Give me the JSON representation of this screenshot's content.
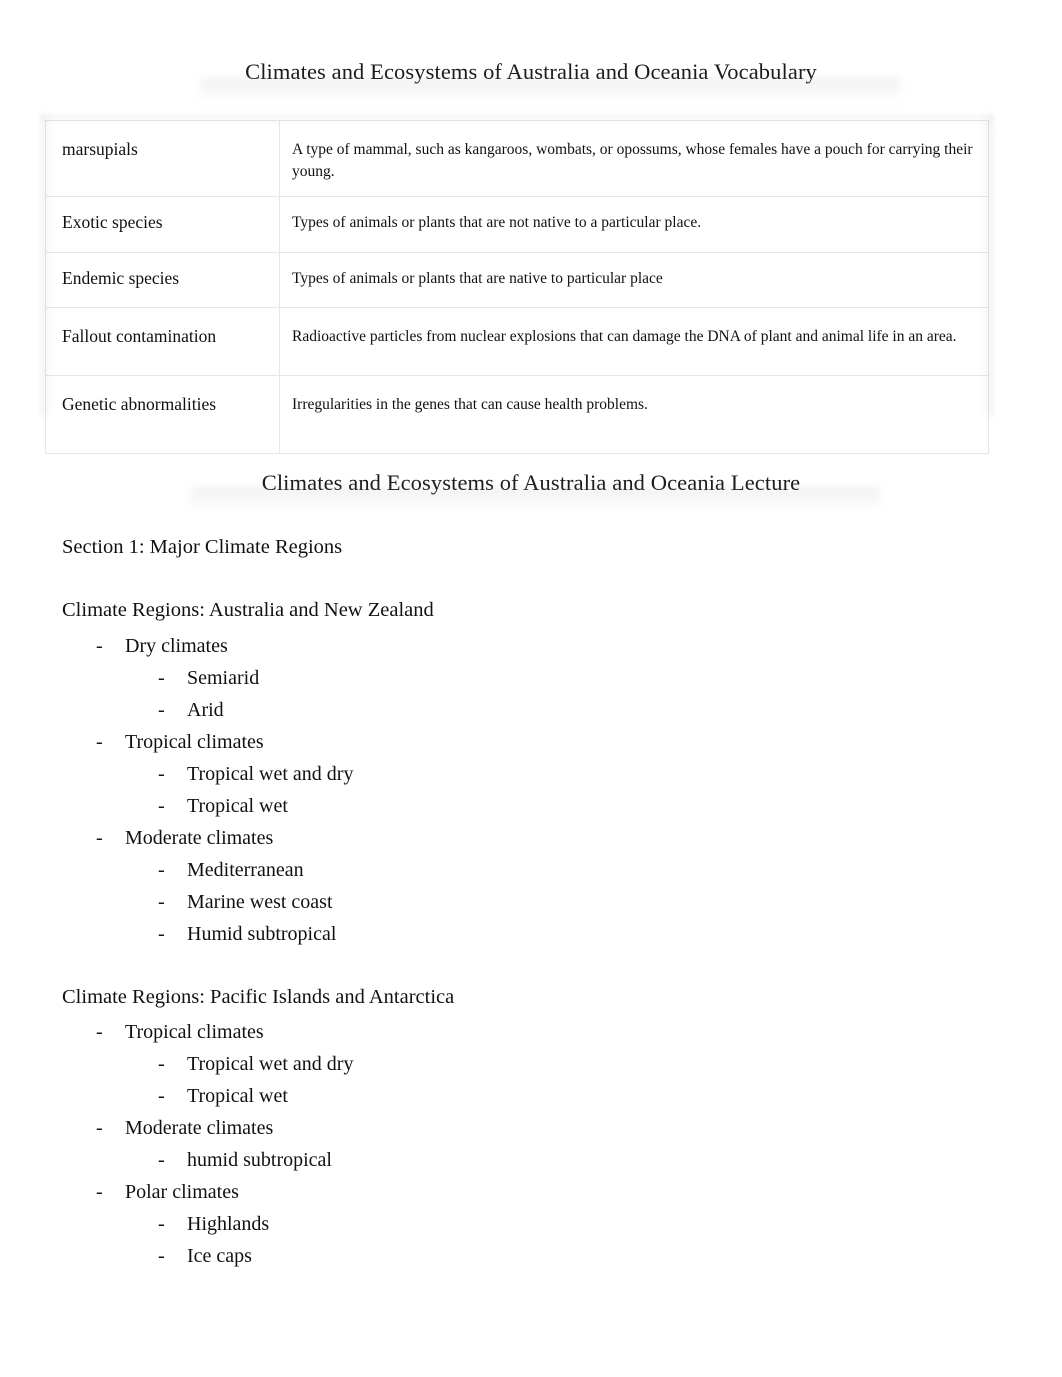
{
  "document": {
    "vocabulary_title": "Climates and Ecosystems of Australia and Oceania Vocabulary",
    "lecture_title": "Climates and Ecosystems of Australia and Oceania Lecture"
  },
  "vocabulary_table": {
    "rows": [
      {
        "term": "marsupials",
        "definition": "A type of mammal, such as kangaroos, wombats, or opossums, whose females have a pouch for carrying their young."
      },
      {
        "term": "Exotic species",
        "definition": "Types of animals or plants that are not native to a particular place."
      },
      {
        "term": "Endemic species",
        "definition": "Types of animals or plants that are native to particular place"
      },
      {
        "term": "Fallout contamination",
        "definition": "Radioactive particles from nuclear explosions that can damage the DNA of plant and animal life in an area."
      },
      {
        "term": "Genetic abnormalities",
        "definition": "Irregularities in the genes that can cause health problems."
      }
    ]
  },
  "lecture": {
    "section_1_heading": "Section 1: Major Climate Regions",
    "regions": [
      {
        "heading": "Climate Regions: Australia and New Zealand",
        "items": [
          {
            "level": 1,
            "text": "Dry climates"
          },
          {
            "level": 2,
            "text": "Semiarid"
          },
          {
            "level": 2,
            "text": "Arid"
          },
          {
            "level": 1,
            "text": "Tropical climates"
          },
          {
            "level": 2,
            "text": "Tropical wet and dry"
          },
          {
            "level": 2,
            "text": "Tropical wet"
          },
          {
            "level": 1,
            "text": "Moderate climates"
          },
          {
            "level": 2,
            "text": "Mediterranean"
          },
          {
            "level": 2,
            "text": "Marine west coast"
          },
          {
            "level": 2,
            "text": "Humid subtropical"
          }
        ]
      },
      {
        "heading": "Climate Regions: Pacific Islands and Antarctica",
        "items": [
          {
            "level": 1,
            "text": "Tropical climates"
          },
          {
            "level": 2,
            "text": "Tropical wet and dry"
          },
          {
            "level": 2,
            "text": "Tropical wet"
          },
          {
            "level": 1,
            "text": "Moderate climates"
          },
          {
            "level": 2,
            "text": "humid subtropical"
          },
          {
            "level": 1,
            "text": "Polar climates"
          },
          {
            "level": 2,
            "text": "Highlands"
          },
          {
            "level": 2,
            "text": "Ice caps"
          }
        ]
      }
    ],
    "bullet_marker": "-"
  },
  "colors": {
    "text": "#111111",
    "table_border": "#e6e6e6",
    "page_background": "#ffffff"
  }
}
